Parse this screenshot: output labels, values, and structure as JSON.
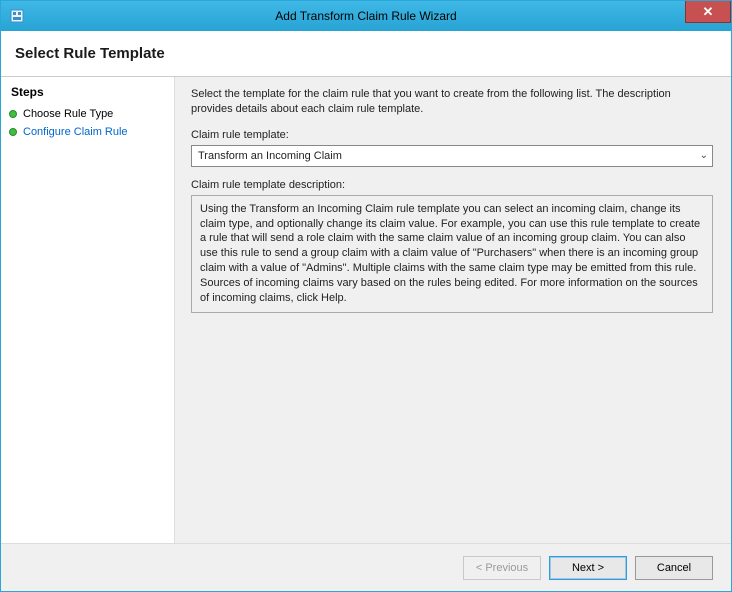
{
  "window": {
    "title": "Add Transform Claim Rule Wizard"
  },
  "header": {
    "title": "Select Rule Template"
  },
  "sidebar": {
    "heading": "Steps",
    "items": [
      {
        "label": "Choose Rule Type"
      },
      {
        "label": "Configure Claim Rule"
      }
    ]
  },
  "main": {
    "intro": "Select the template for the claim rule that you want to create from the following list. The description provides details about each claim rule template.",
    "template_label": "Claim rule template:",
    "template_selected": "Transform an Incoming Claim",
    "description_label": "Claim rule template description:",
    "description_text": "Using the Transform an Incoming Claim rule template you can select an incoming claim, change its claim type, and optionally change its claim value.  For example, you can use this rule template to create a rule that will send a role claim with the same claim value of an incoming group claim.  You can also use this rule to send a group claim with a claim value of \"Purchasers\" when there is an incoming group claim with a value of \"Admins\".  Multiple claims with the same claim type may be emitted from this rule.  Sources of incoming claims vary based on the rules being edited.  For more information on the sources of incoming claims, click Help."
  },
  "footer": {
    "previous_label": "< Previous",
    "next_label": "Next >",
    "cancel_label": "Cancel"
  }
}
